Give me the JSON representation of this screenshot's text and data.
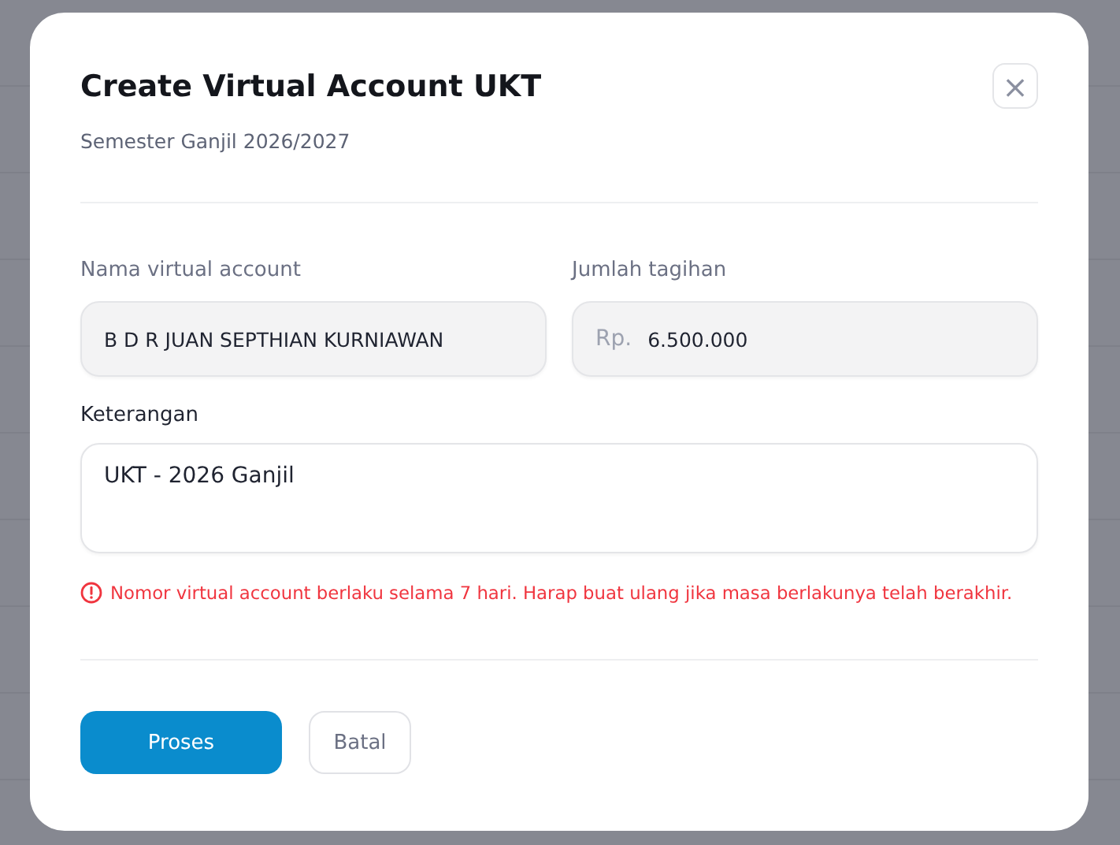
{
  "dialog": {
    "title": "Create Virtual Account UKT",
    "subtitle": "Semester Ganjil 2026/2027",
    "close_icon": "×",
    "fields": [
      {
        "label": "Nama virtual account",
        "value": "B D R JUAN SEPTHIAN KURNIAWAN",
        "disabled": true
      },
      {
        "label": "Jumlah tagihan",
        "prefix": "Rp.",
        "value": "6.500.000",
        "disabled": true
      }
    ],
    "note": {
      "label": "Keterangan",
      "value": "UKT - 2026 Ganjil"
    },
    "warning": "Nomor virtual account berlaku selama 7 hari. Harap buat ulang jika masa berlakunya telah berakhir.",
    "buttons": [
      {
        "label": "Proses",
        "kind": "primary"
      },
      {
        "label": "Batal",
        "kind": "secondary"
      }
    ]
  }
}
